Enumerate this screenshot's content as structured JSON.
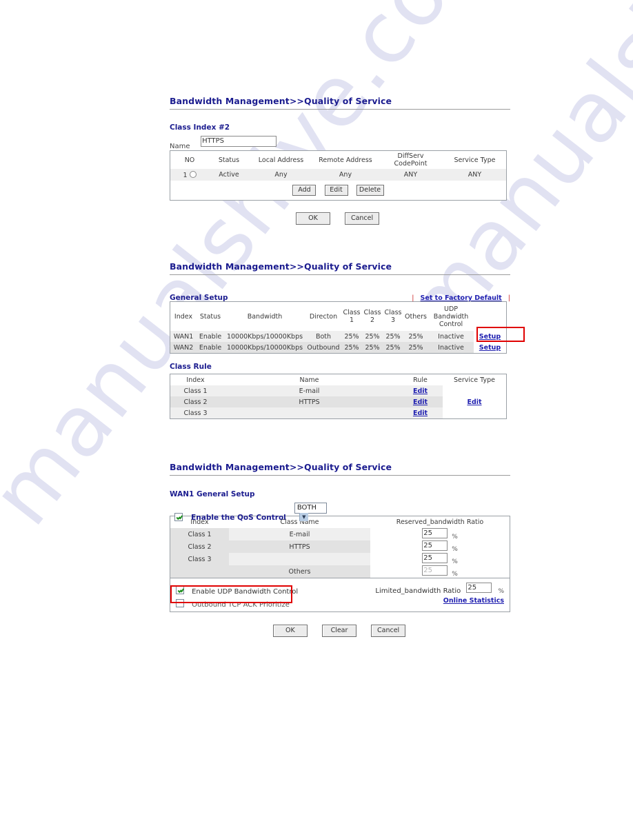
{
  "watermark": {
    "line1": "manualshive.com",
    "line2": "manualshive.com"
  },
  "panel1": {
    "title_main": "Bandwidth Management",
    "title_sep": ">>",
    "title_tail": "Quality of Service",
    "section": "Class Index #2",
    "name_label": "Name",
    "name_value": "HTTPS",
    "columns": [
      "NO",
      "Status",
      "Local Address",
      "Remote Address",
      "DiffServ CodePoint",
      "Service Type"
    ],
    "col_diffserv_l1": "DiffServ",
    "col_diffserv_l2": "CodePoint",
    "rows": [
      {
        "no": "1",
        "status": "Active",
        "local": "Any",
        "remote": "Any",
        "diffserv": "ANY",
        "service": "ANY"
      }
    ],
    "buttons": {
      "add": "Add",
      "edit": "Edit",
      "delete": "Delete"
    },
    "footer_buttons": {
      "ok": "OK",
      "cancel": "Cancel"
    }
  },
  "panel2": {
    "title_main": "Bandwidth Management",
    "title_sep": ">>",
    "title_tail": "Quality of Service",
    "general_setup_label": "General Setup",
    "factory_default_link": "Set to Factory Default",
    "bar": "|",
    "columns": {
      "index": "Index",
      "status": "Status",
      "bandwidth": "Bandwidth",
      "direction": "Directon",
      "class1_l1": "Class",
      "class1_l2": "1",
      "class2_l1": "Class",
      "class2_l2": "2",
      "class3_l1": "Class",
      "class3_l2": "3",
      "others": "Others",
      "udp_l1": "UDP",
      "udp_l2": "Bandwidth",
      "udp_l3": "Control",
      "setup": ""
    },
    "rows": [
      {
        "index": "WAN1",
        "status": "Enable",
        "bandwidth": "10000Kbps/10000Kbps",
        "direction": "Both",
        "c1": "25%",
        "c2": "25%",
        "c3": "25%",
        "others": "25%",
        "udp": "Inactive",
        "setup": "Setup"
      },
      {
        "index": "WAN2",
        "status": "Enable",
        "bandwidth": "10000Kbps/10000Kbps",
        "direction": "Outbound",
        "c1": "25%",
        "c2": "25%",
        "c3": "25%",
        "others": "25%",
        "udp": "Inactive",
        "setup": "Setup"
      }
    ],
    "class_rule_label": "Class Rule",
    "rule_columns": [
      "Index",
      "Name",
      "Rule",
      "Service Type"
    ],
    "rule_rows": [
      {
        "index": "Class 1",
        "name": "E-mail",
        "rule": "Edit"
      },
      {
        "index": "Class 2",
        "name": "HTTPS",
        "rule": "Edit"
      },
      {
        "index": "Class 3",
        "name": "",
        "rule": "Edit"
      }
    ],
    "service_type_link": "Edit"
  },
  "panel3": {
    "title_main": "Bandwidth Management",
    "title_sep": ">>",
    "title_tail": "Quality of Service",
    "section": "WAN1 General Setup",
    "enable_qos_label": "Enable the QoS Control",
    "qos_direction_value": "BOTH",
    "columns": [
      "Index",
      "Class Name",
      "Reserved_bandwidth Ratio"
    ],
    "rows": [
      {
        "index": "Class 1",
        "name": "E-mail",
        "ratio": "25",
        "unit": "%",
        "disabled": false
      },
      {
        "index": "Class 2",
        "name": "HTTPS",
        "ratio": "25",
        "unit": "%",
        "disabled": false
      },
      {
        "index": "Class 3",
        "name": "",
        "ratio": "25",
        "unit": "%",
        "disabled": false
      },
      {
        "index": "",
        "name": "Others",
        "ratio": "25",
        "unit": "%",
        "disabled": true
      }
    ],
    "udp_checkbox_label": "Enable UDP Bandwidth Control",
    "tcp_ack_label": "Outbound TCP ACK Prioritize",
    "limited_label": "Limited_bandwidth Ratio",
    "limited_value": "25",
    "limited_unit": "%",
    "online_stats_link": "Online Statistics",
    "footer_buttons": {
      "ok": "OK",
      "clear": "Clear",
      "cancel": "Cancel"
    }
  },
  "colors": {
    "heading": "#1b1c8f",
    "link": "#1f1fb0",
    "highlight": "#e00000",
    "watermark": "#c9cbe8"
  }
}
